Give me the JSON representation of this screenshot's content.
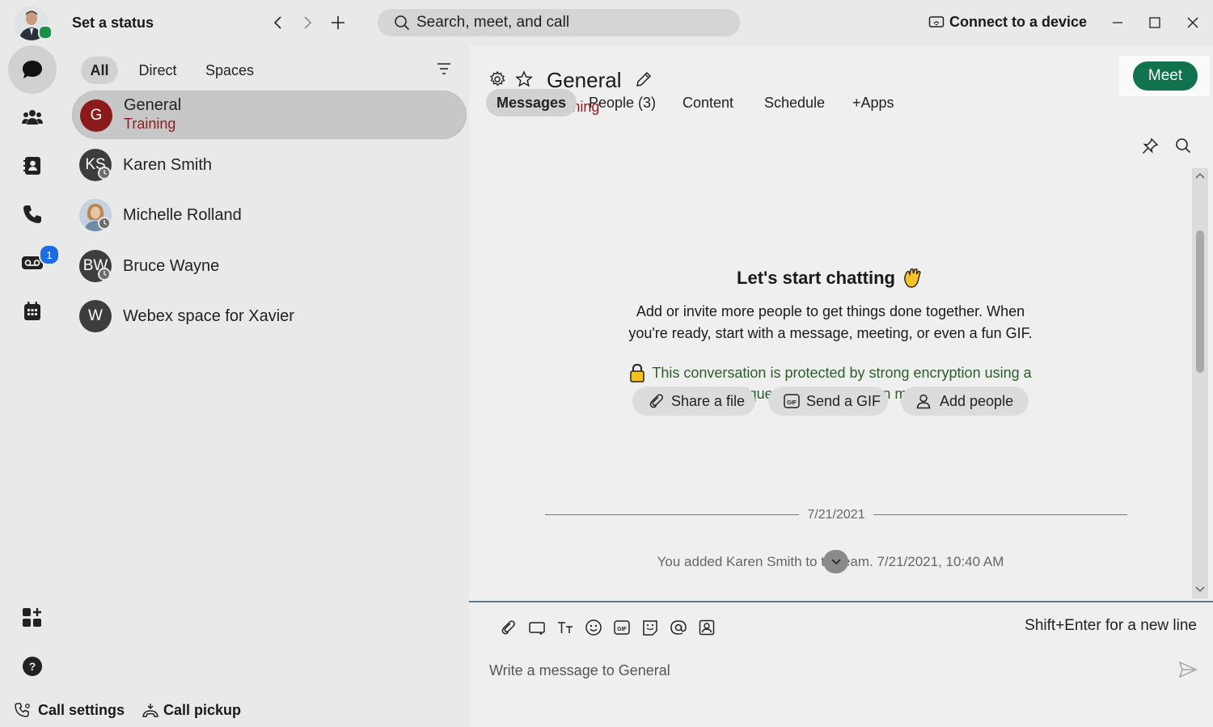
{
  "titlebar": {
    "status_label": "Set a status",
    "search_placeholder": "Search, meet, and call",
    "connect_label": "Connect to a device"
  },
  "rail": {
    "voicemail_badge": "1",
    "items": [
      "messaging-icon",
      "teams-icon",
      "contacts-icon",
      "calling-icon",
      "voicemail-icon",
      "calendar-icon",
      "apps-icon",
      "help-icon"
    ]
  },
  "list": {
    "filters": [
      "All",
      "Direct",
      "Spaces"
    ],
    "items": [
      {
        "initials": "G",
        "name": "General",
        "subtitle": "Training"
      },
      {
        "initials": "KS",
        "name": "Karen Smith"
      },
      {
        "initials": "",
        "name": "Michelle Rolland"
      },
      {
        "initials": "BW",
        "name": "Bruce Wayne"
      },
      {
        "initials": "W",
        "name": "Webex space for Xavier"
      }
    ]
  },
  "footer": {
    "call_settings": "Call settings",
    "call_pickup": "Call pickup"
  },
  "space": {
    "title": "General",
    "team": "Training",
    "meet_label": "Meet",
    "tabs": [
      "Messages",
      "People (3)",
      "Content",
      "Schedule",
      "+Apps"
    ]
  },
  "empty_state": {
    "heading": "Let's start chatting",
    "line1": "Add or invite more people to get things done together. When",
    "line2": "you're ready, start with a message, meeting, or even a fun GIF.",
    "enc_line1": "This conversation is protected by strong encryption using a",
    "enc_line2": "unique key. Click to learn more.",
    "actions": [
      "Share a file",
      "Send a GIF",
      "Add people"
    ]
  },
  "timeline": {
    "date": "7/21/2021",
    "activity_before": "You added Karen Smith to t",
    "activity_after": "eam. 7/21/2021, 10:40 AM"
  },
  "composer": {
    "hint": "Shift+Enter for a new line",
    "placeholder": "Write a message to General"
  },
  "colors": {
    "meet_green": "#11724e",
    "space_red": "#8b1a1a",
    "encryption_green": "#2c5e2c",
    "badge_blue": "#1d6ce0"
  }
}
